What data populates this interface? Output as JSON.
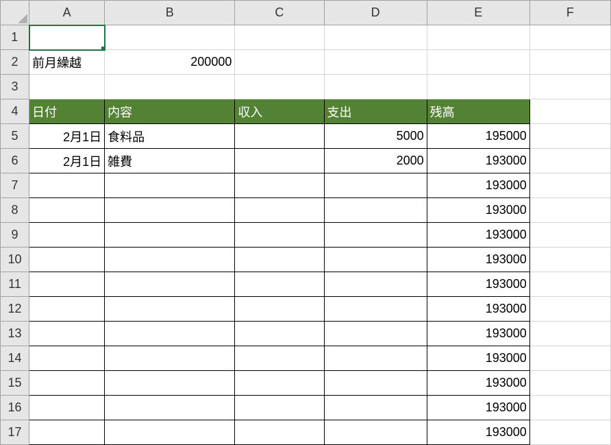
{
  "columns": [
    "A",
    "B",
    "C",
    "D",
    "E",
    "F"
  ],
  "rowCount": 17,
  "selectedCell": "A1",
  "cells": {
    "A2": {
      "text": "前月繰越",
      "align": "left"
    },
    "B2": {
      "text": "200000",
      "align": "right"
    },
    "A4": {
      "text": "日付",
      "align": "left",
      "headerGreen": true
    },
    "B4": {
      "text": "内容",
      "align": "left",
      "headerGreen": true
    },
    "C4": {
      "text": "収入",
      "align": "left",
      "headerGreen": true
    },
    "D4": {
      "text": "支出",
      "align": "left",
      "headerGreen": true
    },
    "E4": {
      "text": "残高",
      "align": "left",
      "headerGreen": true
    },
    "A5": {
      "text": "2月1日",
      "align": "right",
      "bordered": true
    },
    "B5": {
      "text": "食料品",
      "align": "left",
      "bordered": true
    },
    "C5": {
      "text": "",
      "bordered": true
    },
    "D5": {
      "text": "5000",
      "align": "right",
      "bordered": true
    },
    "E5": {
      "text": "195000",
      "align": "right",
      "bordered": true
    },
    "A6": {
      "text": "2月1日",
      "align": "right",
      "bordered": true
    },
    "B6": {
      "text": "雑費",
      "align": "left",
      "bordered": true
    },
    "C6": {
      "text": "",
      "bordered": true
    },
    "D6": {
      "text": "2000",
      "align": "right",
      "bordered": true
    },
    "E6": {
      "text": "193000",
      "align": "right",
      "bordered": true
    },
    "A7": {
      "bordered": true
    },
    "B7": {
      "bordered": true
    },
    "C7": {
      "bordered": true
    },
    "D7": {
      "bordered": true
    },
    "E7": {
      "text": "193000",
      "align": "right",
      "bordered": true
    },
    "A8": {
      "bordered": true
    },
    "B8": {
      "bordered": true
    },
    "C8": {
      "bordered": true
    },
    "D8": {
      "bordered": true
    },
    "E8": {
      "text": "193000",
      "align": "right",
      "bordered": true
    },
    "A9": {
      "bordered": true
    },
    "B9": {
      "bordered": true
    },
    "C9": {
      "bordered": true
    },
    "D9": {
      "bordered": true
    },
    "E9": {
      "text": "193000",
      "align": "right",
      "bordered": true
    },
    "A10": {
      "bordered": true
    },
    "B10": {
      "bordered": true
    },
    "C10": {
      "bordered": true
    },
    "D10": {
      "bordered": true
    },
    "E10": {
      "text": "193000",
      "align": "right",
      "bordered": true
    },
    "A11": {
      "bordered": true
    },
    "B11": {
      "bordered": true
    },
    "C11": {
      "bordered": true
    },
    "D11": {
      "bordered": true
    },
    "E11": {
      "text": "193000",
      "align": "right",
      "bordered": true
    },
    "A12": {
      "bordered": true
    },
    "B12": {
      "bordered": true
    },
    "C12": {
      "bordered": true
    },
    "D12": {
      "bordered": true
    },
    "E12": {
      "text": "193000",
      "align": "right",
      "bordered": true
    },
    "A13": {
      "bordered": true
    },
    "B13": {
      "bordered": true
    },
    "C13": {
      "bordered": true
    },
    "D13": {
      "bordered": true
    },
    "E13": {
      "text": "193000",
      "align": "right",
      "bordered": true
    },
    "A14": {
      "bordered": true
    },
    "B14": {
      "bordered": true
    },
    "C14": {
      "bordered": true
    },
    "D14": {
      "bordered": true
    },
    "E14": {
      "text": "193000",
      "align": "right",
      "bordered": true
    },
    "A15": {
      "bordered": true
    },
    "B15": {
      "bordered": true
    },
    "C15": {
      "bordered": true
    },
    "D15": {
      "bordered": true
    },
    "E15": {
      "text": "193000",
      "align": "right",
      "bordered": true
    },
    "A16": {
      "bordered": true
    },
    "B16": {
      "bordered": true
    },
    "C16": {
      "bordered": true
    },
    "D16": {
      "bordered": true
    },
    "E16": {
      "text": "193000",
      "align": "right",
      "bordered": true
    },
    "A17": {
      "bordered": true
    },
    "B17": {
      "bordered": true
    },
    "C17": {
      "bordered": true
    },
    "D17": {
      "bordered": true
    },
    "E17": {
      "text": "193000",
      "align": "right",
      "bordered": true
    }
  }
}
